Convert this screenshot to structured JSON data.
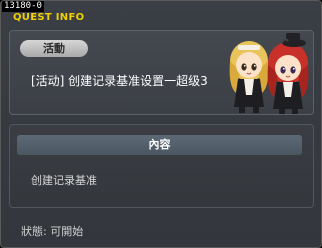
{
  "window": {
    "id_tag": "13180-0",
    "title": "QUEST INFO"
  },
  "quest": {
    "category_badge": "活動",
    "name": "[活动] 创建记录基准设置一超级3"
  },
  "content": {
    "header": "內容",
    "text": "创建记录基准"
  },
  "status": {
    "text": "狀態:  可開始"
  },
  "colors": {
    "title": "#f0d000",
    "background": "#383c42"
  }
}
